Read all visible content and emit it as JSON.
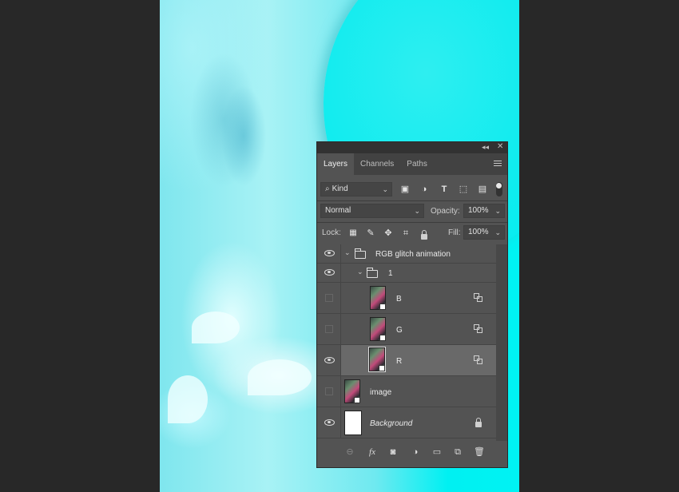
{
  "app": {
    "panel_title": "Layers"
  },
  "tabs": [
    {
      "label": "Layers",
      "active": true
    },
    {
      "label": "Channels",
      "active": false
    },
    {
      "label": "Paths",
      "active": false
    }
  ],
  "filter": {
    "kind_label": "Kind",
    "icons": [
      "image-filter-icon",
      "adjustment-filter-icon",
      "type-filter-icon",
      "shape-filter-icon",
      "smart-object-filter-icon",
      "filter-toggle"
    ]
  },
  "blend": {
    "mode": "Normal",
    "opacity_label": "Opacity:",
    "opacity_value": "100%"
  },
  "lock": {
    "label": "Lock:",
    "fill_label": "Fill:",
    "fill_value": "100%"
  },
  "layers": [
    {
      "name": "RGB glitch animation",
      "type": "group",
      "visible": true,
      "indent": 0
    },
    {
      "name": "1",
      "type": "group",
      "visible": true,
      "indent": 1
    },
    {
      "name": "B",
      "type": "smart-object",
      "visible": false,
      "indent": 2,
      "linked": true
    },
    {
      "name": "G",
      "type": "smart-object",
      "visible": false,
      "indent": 2,
      "linked": true
    },
    {
      "name": "R",
      "type": "smart-object",
      "visible": true,
      "indent": 2,
      "linked": true,
      "selected": true
    },
    {
      "name": "image",
      "type": "smart-object",
      "visible": false,
      "indent": 0
    },
    {
      "name": "Background",
      "type": "background",
      "visible": true,
      "indent": 0,
      "locked": true
    }
  ],
  "colors": {
    "panel_bg": "#535353",
    "selected_row": "#696969",
    "canvas_cyan": "#00f0f2"
  }
}
